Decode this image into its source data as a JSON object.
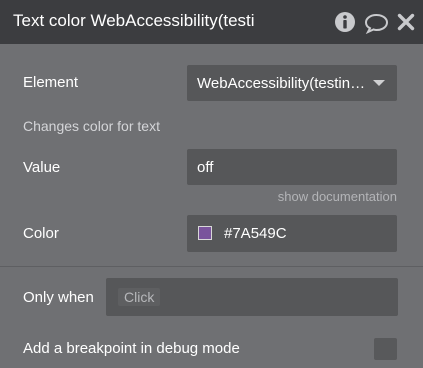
{
  "header": {
    "title": "Text color WebAccessibility(testi"
  },
  "form": {
    "element_label": "Element",
    "element_value": "WebAccessibility(testing...",
    "description": "Changes color for text",
    "value_label": "Value",
    "value_value": "off",
    "doc_link": "show documentation",
    "color_label": "Color",
    "color_value": "#7A549C",
    "only_when_label": "Only when",
    "only_when_placeholder": "Click",
    "breakpoint_label": "Add a breakpoint in debug mode"
  },
  "colors": {
    "header_bg": "#3c3d40",
    "panel_bg": "#6f7073",
    "field_bg": "#565759",
    "swatch": "#7A549C"
  },
  "icons": [
    "info-icon",
    "comment-icon",
    "close-icon",
    "chevron-down-icon"
  ]
}
